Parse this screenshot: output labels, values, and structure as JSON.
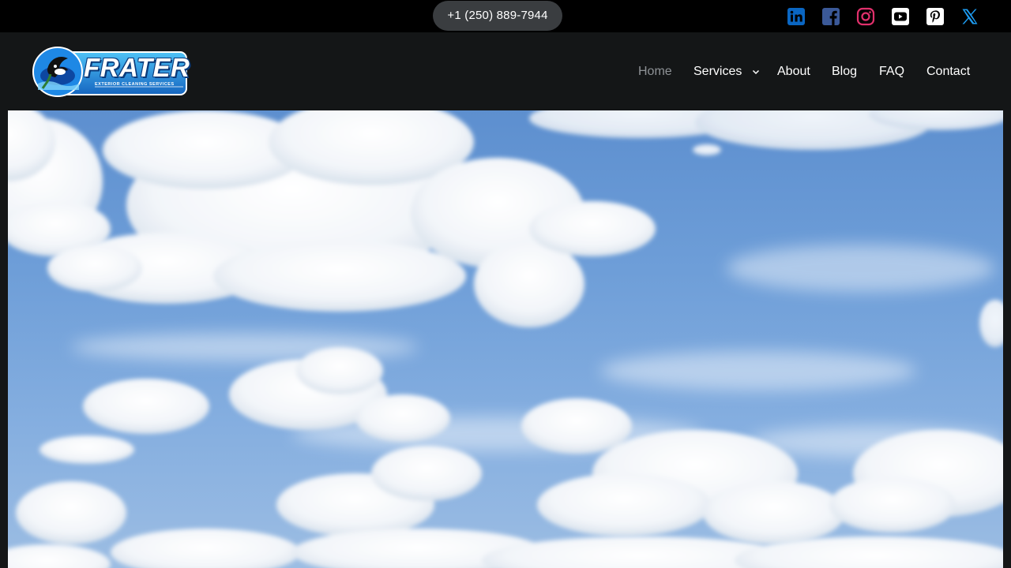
{
  "topbar": {
    "phone": "+1 (250) 889-7944",
    "social": [
      {
        "name": "linkedin-icon",
        "color": "#0a66c2"
      },
      {
        "name": "facebook-icon",
        "color": "#3b5998"
      },
      {
        "name": "instagram-icon",
        "color": "#e1306c"
      },
      {
        "name": "youtube-icon",
        "color": "#ffffff"
      },
      {
        "name": "pinterest-icon",
        "color": "#ffffff"
      },
      {
        "name": "x-icon",
        "color": "#1d9bf0"
      }
    ]
  },
  "logo": {
    "word": "FRATER",
    "subtitle": "EXTERIOR CLEANING SERVICES"
  },
  "nav": {
    "items": [
      {
        "label": "Home",
        "active": true
      },
      {
        "label": "Services",
        "has_dropdown": true
      },
      {
        "label": "About"
      },
      {
        "label": "Blog"
      },
      {
        "label": "FAQ"
      },
      {
        "label": "Contact"
      }
    ]
  },
  "colors": {
    "topbar_bg": "#000000",
    "header_bg": "#141617",
    "nav_active": "#8e9296",
    "sky_blue": "#6e9ed8"
  }
}
